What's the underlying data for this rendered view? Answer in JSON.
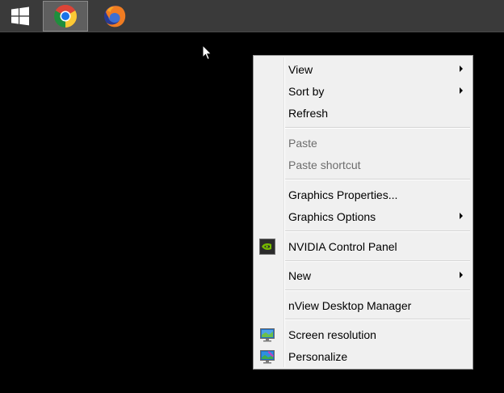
{
  "taskbar": {
    "buttons": [
      {
        "icon": "windows-start-icon"
      },
      {
        "icon": "chrome-icon",
        "active": true
      },
      {
        "icon": "firefox-icon"
      }
    ]
  },
  "context_menu": {
    "items": [
      {
        "label": "View",
        "submenu": true,
        "enabled": true
      },
      {
        "label": "Sort by",
        "submenu": true,
        "enabled": true
      },
      {
        "label": "Refresh",
        "submenu": false,
        "enabled": true
      },
      {
        "label": "Paste",
        "submenu": false,
        "enabled": false
      },
      {
        "label": "Paste shortcut",
        "submenu": false,
        "enabled": false
      },
      {
        "label": "Graphics Properties...",
        "submenu": false,
        "enabled": true
      },
      {
        "label": "Graphics Options",
        "submenu": true,
        "enabled": true
      },
      {
        "label": "NVIDIA Control Panel",
        "submenu": false,
        "enabled": true,
        "icon": "nvidia-icon"
      },
      {
        "label": "New",
        "submenu": true,
        "enabled": true
      },
      {
        "label": "nView Desktop Manager",
        "submenu": false,
        "enabled": true
      },
      {
        "label": "Screen resolution",
        "submenu": false,
        "enabled": true,
        "icon": "monitor-icon"
      },
      {
        "label": "Personalize",
        "submenu": false,
        "enabled": true,
        "icon": "personalize-icon"
      }
    ]
  },
  "colors": {
    "desktop": "#000000",
    "taskbar": "#3a3a3a",
    "menu_bg": "#f0f0f0",
    "menu_text": "#000000",
    "menu_disabled_text": "#6d6d6d"
  }
}
